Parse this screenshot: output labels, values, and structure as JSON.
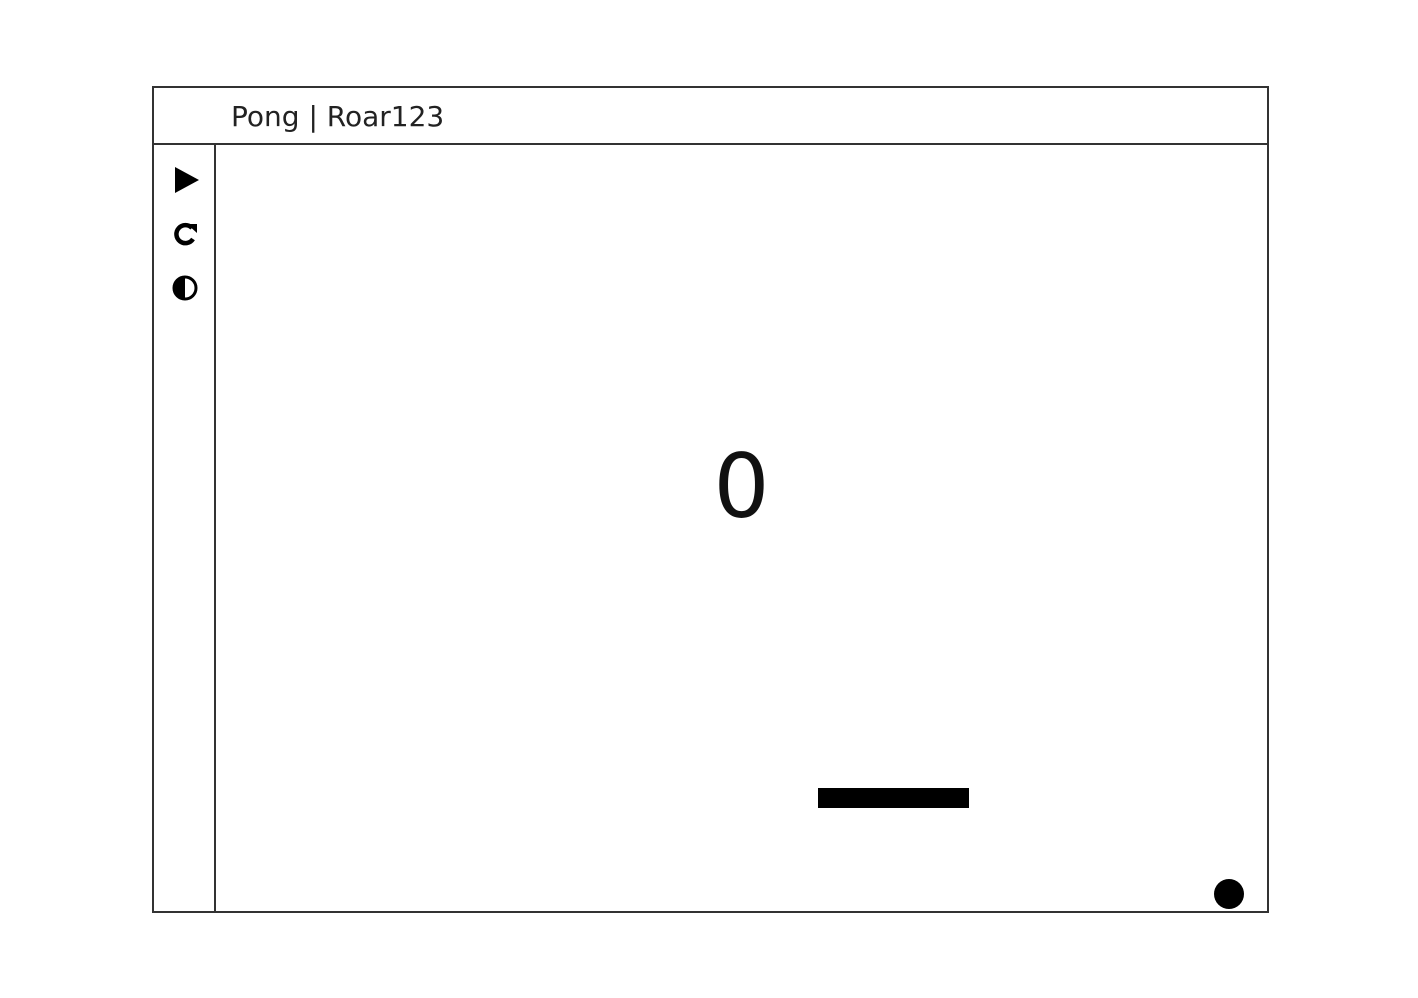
{
  "window": {
    "title": "Pong | Roar123"
  },
  "toolbar": {
    "buttons": [
      {
        "icon": "play-icon",
        "action": "play"
      },
      {
        "icon": "restart-icon",
        "action": "restart"
      },
      {
        "icon": "contrast-icon",
        "action": "toggle-theme"
      }
    ]
  },
  "game": {
    "score": "0"
  },
  "colors": {
    "foreground": "#000000",
    "background": "#ffffff",
    "border": "#333333"
  }
}
